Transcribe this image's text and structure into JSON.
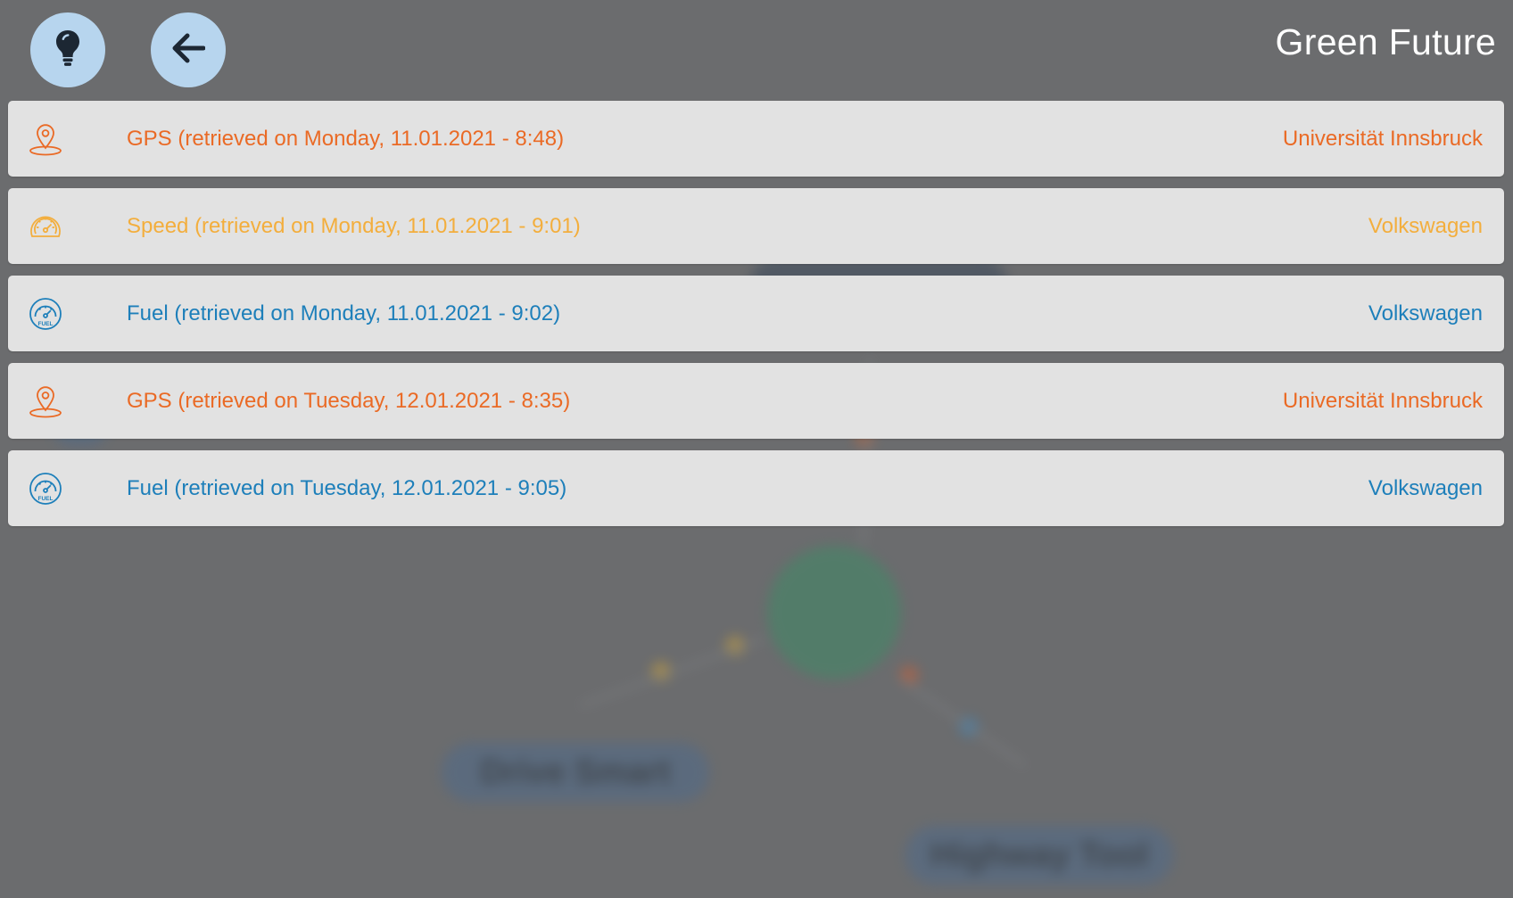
{
  "app": {
    "title": "Green Future"
  },
  "colors": {
    "gps": "#ea6a25",
    "speed": "#f3ae3d",
    "fuel": "#1d7fba",
    "button_bg": "#b7d5ee",
    "overlay_bg": "#6b6c6e"
  },
  "toolbar": {
    "hint_icon": "lightbulb-icon",
    "back_icon": "arrow-left-icon"
  },
  "background_graph": {
    "labels": [
      "Drive Smart",
      "Highway Tool"
    ]
  },
  "data_list": [
    {
      "type": "gps",
      "icon": "map-pin-icon",
      "label": "GPS (retrieved on Monday, 11.01.2021 - 8:48)",
      "source": "Universität Innsbruck",
      "color": "#ea6a25"
    },
    {
      "type": "speed",
      "icon": "speedometer-icon",
      "label": "Speed (retrieved on Monday, 11.01.2021 - 9:01)",
      "source": "Volkswagen",
      "color": "#f3ae3d"
    },
    {
      "type": "fuel",
      "icon": "fuel-gauge-icon",
      "label": "Fuel (retrieved on Monday, 11.01.2021 - 9:02)",
      "source": "Volkswagen",
      "color": "#1d7fba"
    },
    {
      "type": "gps",
      "icon": "map-pin-icon",
      "label": "GPS (retrieved on Tuesday, 12.01.2021 - 8:35)",
      "source": "Universität Innsbruck",
      "color": "#ea6a25"
    },
    {
      "type": "fuel",
      "icon": "fuel-gauge-icon",
      "label": "Fuel (retrieved on Tuesday, 12.01.2021 - 9:05)",
      "source": "Volkswagen",
      "color": "#1d7fba"
    }
  ]
}
